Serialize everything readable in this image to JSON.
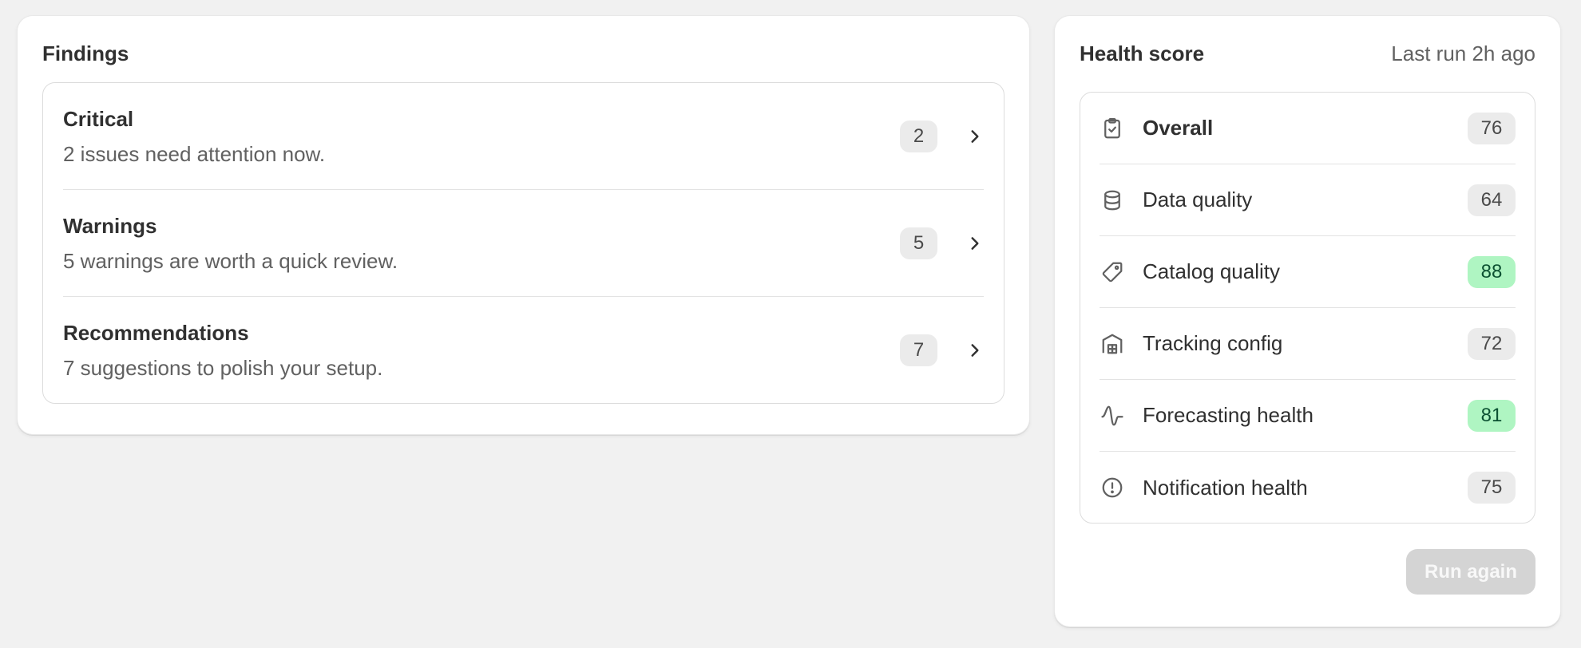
{
  "findings": {
    "title": "Findings",
    "items": [
      {
        "title": "Critical",
        "description": "2 issues need attention now.",
        "count": "2"
      },
      {
        "title": "Warnings",
        "description": "5 warnings are worth a quick review.",
        "count": "5"
      },
      {
        "title": "Recommendations",
        "description": "7 suggestions to polish your setup.",
        "count": "7"
      }
    ]
  },
  "health": {
    "title": "Health score",
    "last_run": "Last run 2h ago",
    "metrics": [
      {
        "label": "Overall",
        "score": "76",
        "icon": "clipboard-check-icon",
        "status": "neutral"
      },
      {
        "label": "Data quality",
        "score": "64",
        "icon": "database-icon",
        "status": "neutral"
      },
      {
        "label": "Catalog quality",
        "score": "88",
        "icon": "tag-icon",
        "status": "good"
      },
      {
        "label": "Tracking config",
        "score": "72",
        "icon": "warehouse-icon",
        "status": "neutral"
      },
      {
        "label": "Forecasting health",
        "score": "81",
        "icon": "wave-icon",
        "status": "good"
      },
      {
        "label": "Notification health",
        "score": "75",
        "icon": "alert-circle-icon",
        "status": "neutral"
      }
    ],
    "run_again_label": "Run again"
  },
  "colors": {
    "good_badge_bg": "#aff5c2",
    "good_badge_text": "#0c5132",
    "neutral_badge_bg": "#ebebeb",
    "disabled_button_bg": "#d4d4d4"
  }
}
